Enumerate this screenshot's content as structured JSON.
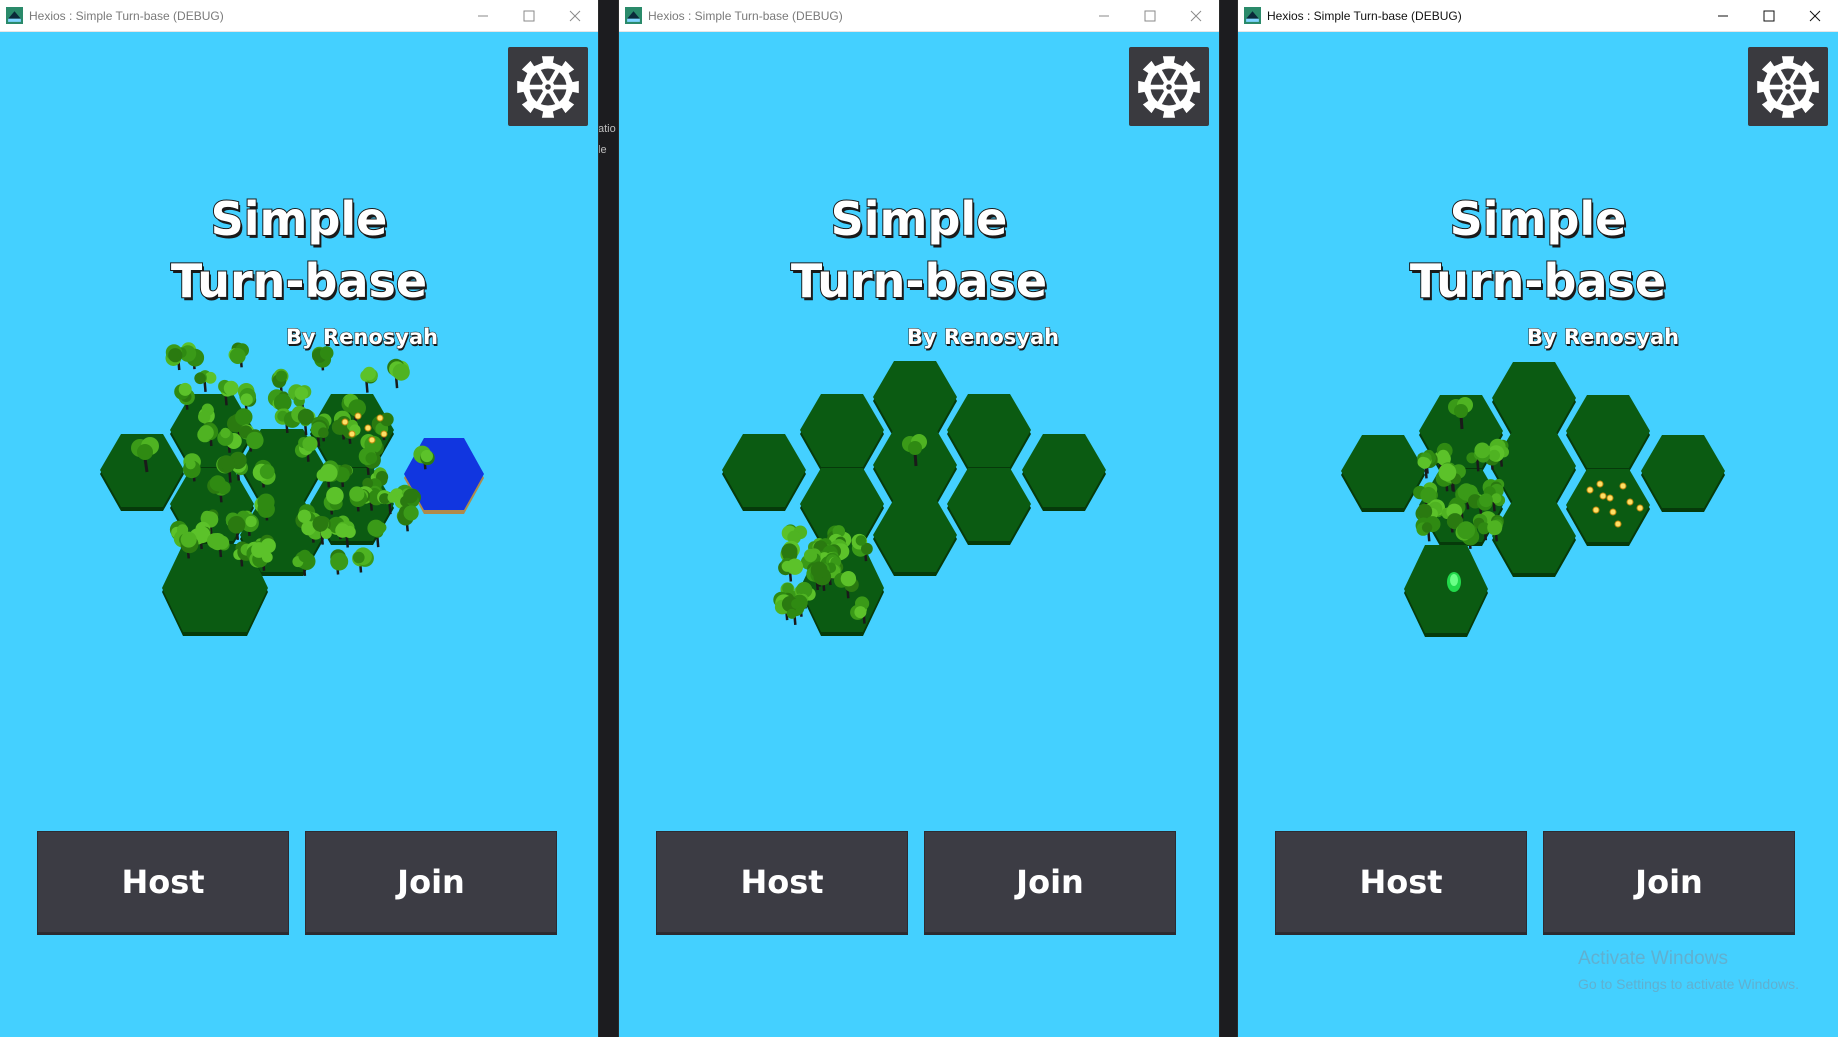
{
  "windows": [
    {
      "title": "Hexios : Simple Turn-base (DEBUG)",
      "game_title_line1": "Simple",
      "game_title_line2": "Turn-base",
      "author": "By Renosyah",
      "host_label": "Host",
      "join_label": "Join",
      "settings_icon": "gear-icon"
    },
    {
      "title": "Hexios : Simple Turn-base (DEBUG)",
      "game_title_line1": "Simple",
      "game_title_line2": "Turn-base",
      "author": "By Renosyah",
      "host_label": "Host",
      "join_label": "Join",
      "settings_icon": "gear-icon"
    },
    {
      "title": "Hexios : Simple Turn-base (DEBUG)",
      "game_title_line1": "Simple",
      "game_title_line2": "Turn-base",
      "author": "By Renosyah",
      "host_label": "Host",
      "join_label": "Join",
      "settings_icon": "gear-icon"
    }
  ],
  "background_text": {
    "line1": "atio",
    "line2": "le"
  },
  "os_watermark": {
    "line1": "Activate Windows",
    "line2": "Go to Settings to activate Windows."
  },
  "colors": {
    "sky": "#44d0ff",
    "hex_grass": "#0b5b12",
    "water": "#1136e0",
    "button": "#3c3c44",
    "settings_bg": "#3a3a3f"
  }
}
